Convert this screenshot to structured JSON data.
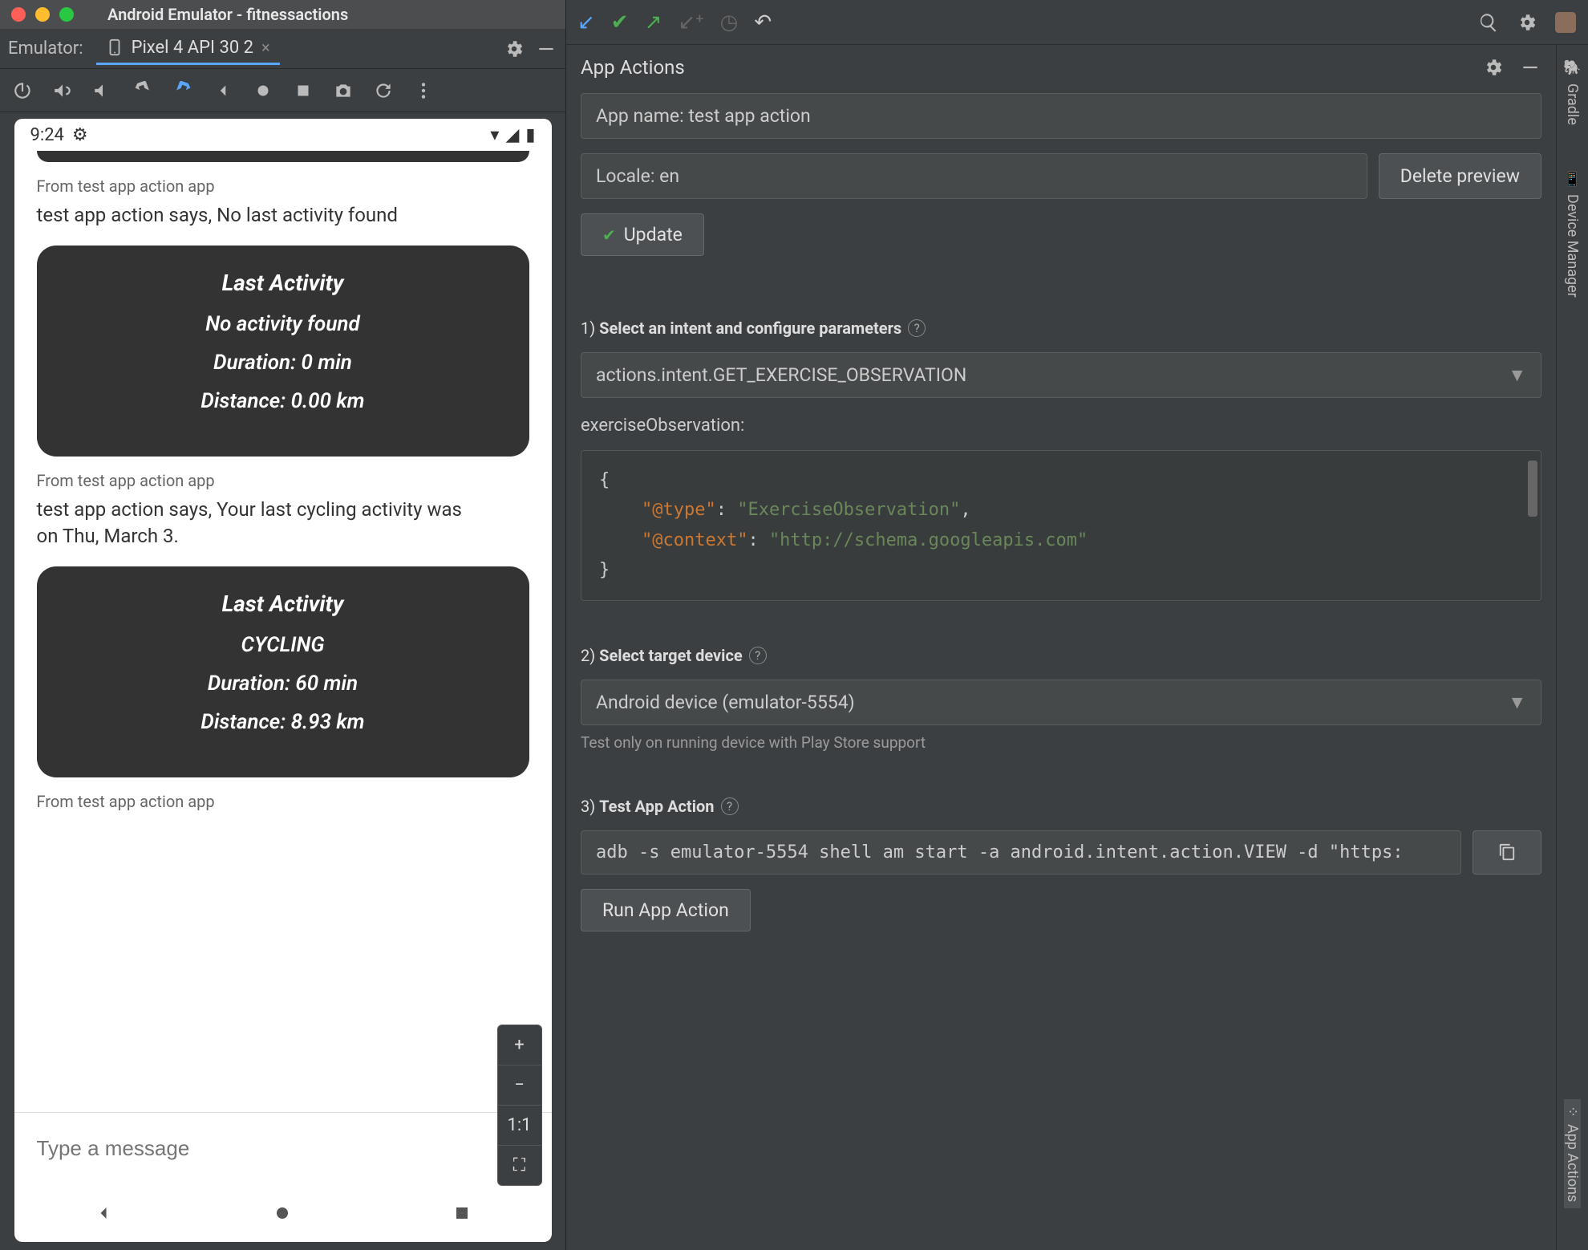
{
  "window": {
    "title": "Android Emulator - fitnessactions"
  },
  "emulator": {
    "label": "Emulator:",
    "tab_name": "Pixel 4 API 30 2"
  },
  "device": {
    "time": "9:24",
    "feed": {
      "from1": "From test app action app",
      "says1": "test app action says, No last activity found",
      "card1": {
        "title": "Last Activity",
        "line1": "No activity found",
        "line2": "Duration: 0 min",
        "line3": "Distance: 0.00 km"
      },
      "from2": "From test app action app",
      "says2": "test app action says, Your last cycling activity was on Thu, March 3.",
      "card2": {
        "title": "Last Activity",
        "line1": "CYCLING",
        "line2": "Duration: 60 min",
        "line3": "Distance: 8.93 km"
      },
      "from3": "From test app action app"
    },
    "input_placeholder": "Type a message",
    "zoom": {
      "plus": "+",
      "minus": "−",
      "ratio": "1:1",
      "fit": "⛶"
    }
  },
  "app_actions": {
    "panel_title": "App Actions",
    "app_name_field": "App name: test app action",
    "locale_field": "Locale: en",
    "delete_preview": "Delete preview",
    "update": "Update",
    "step1": "Select an intent and configure parameters",
    "intent": "actions.intent.GET_EXERCISE_OBSERVATION",
    "param_label": "exerciseObservation:",
    "json_open": "{",
    "json_l1_k": "\"@type\"",
    "json_l1_v": "\"ExerciseObservation\"",
    "json_l2_k": "\"@context\"",
    "json_l2_v": "\"http://schema.googleapis.com\"",
    "json_close": "}",
    "step2": "Select target device",
    "device": "Android device (emulator-5554)",
    "device_hint": "Test only on running device with Play Store support",
    "step3": "Test App Action",
    "adb": "adb -s emulator-5554 shell am start -a android.intent.action.VIEW -d \"https:",
    "run": "Run App Action"
  },
  "side_tabs": {
    "gradle": "Gradle",
    "device_manager": "Device Manager",
    "app_actions": "App Actions"
  }
}
